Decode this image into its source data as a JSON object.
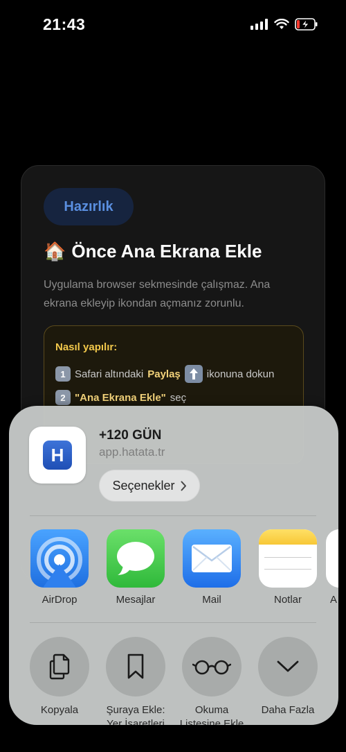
{
  "status": {
    "time": "21:43"
  },
  "card": {
    "pill": "Hazırlık",
    "title_emoji": "🏠",
    "title": "Önce Ana Ekrana Ekle",
    "description": "Uygulama browser sekmesinde çalışmaz. Ana ekrana ekleyip ikondan açmanız zorunlu.",
    "howto_title": "Nasıl yapılır:",
    "step1": {
      "num": "1",
      "pre": "Safari altındaki",
      "bold": "Paylaş",
      "post": "ikonuna dokun"
    },
    "step2": {
      "num": "2",
      "bold": "\"Ana Ekrana Ekle\"",
      "post": "seç"
    }
  },
  "sheet": {
    "app_icon_letter": "H",
    "app_title": "+120 GÜN",
    "app_url": "app.hatata.tr",
    "options_label": "Seçenekler",
    "apps": [
      {
        "label": "AirDrop",
        "icon": "airdrop-icon"
      },
      {
        "label": "Mesajlar",
        "icon": "messages-icon"
      },
      {
        "label": "Mail",
        "icon": "mail-icon"
      },
      {
        "label": "Notlar",
        "icon": "notes-icon"
      },
      {
        "label": "A",
        "icon": "partial-app-icon"
      }
    ],
    "actions": [
      {
        "label": "Kopyala",
        "icon": "copy-icon"
      },
      {
        "label": "Şuraya Ekle:\nYer İşaretleri",
        "icon": "bookmark-icon"
      },
      {
        "label": "Okuma\nListesine Ekle",
        "icon": "glasses-icon"
      },
      {
        "label": "Daha Fazla",
        "icon": "chevron-down-icon"
      }
    ]
  }
}
